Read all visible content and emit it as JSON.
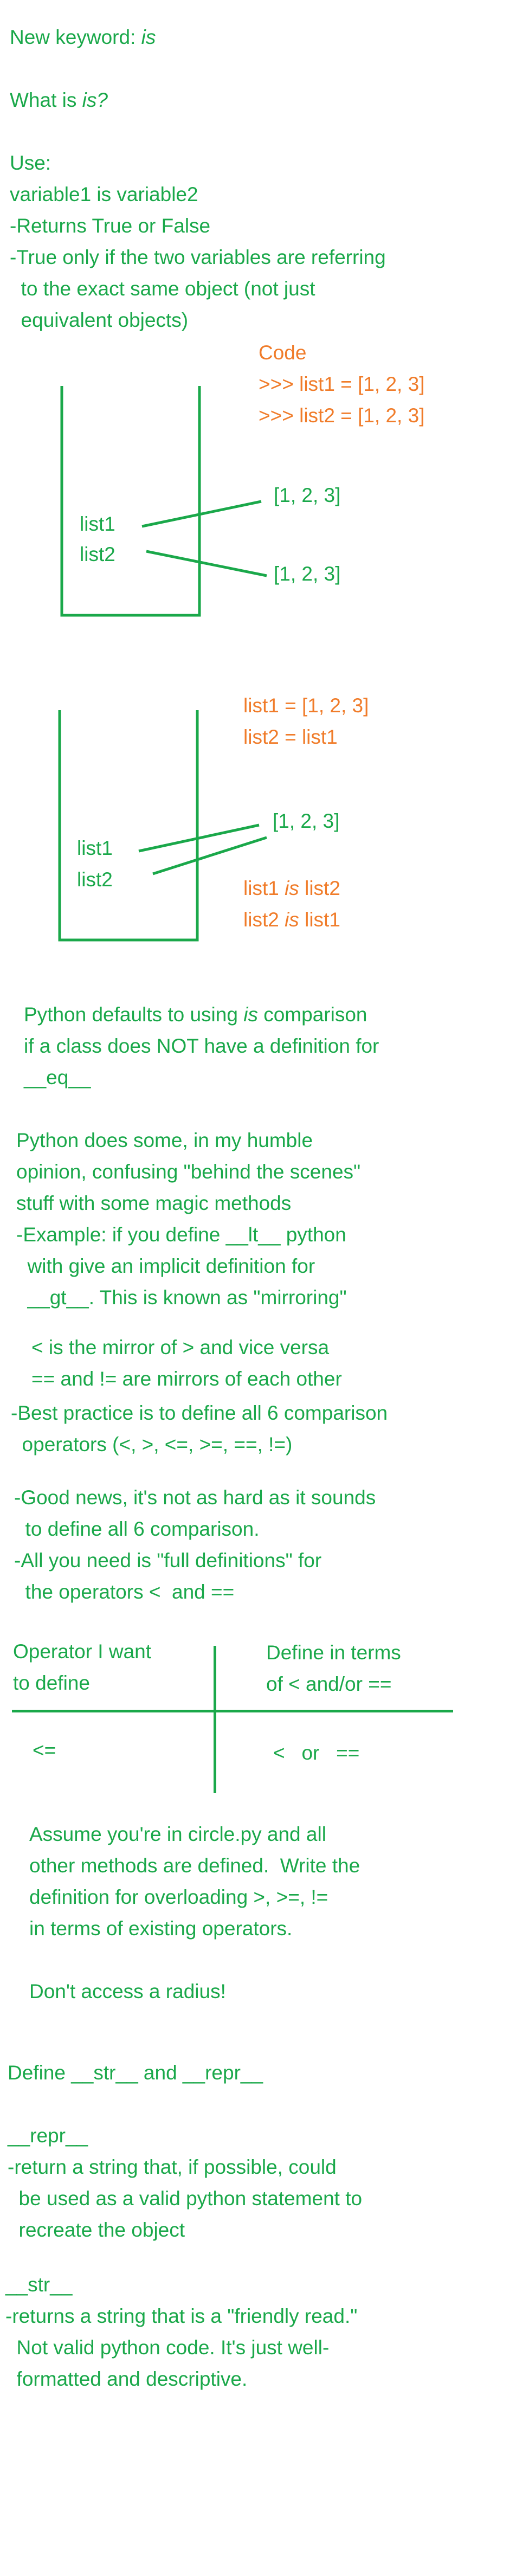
{
  "intro": {
    "new_keyword_prefix": "New keyword: ",
    "new_keyword": "is",
    "what_is_prefix": "What is ",
    "what_is_word": "is?",
    "use_lines": [
      "Use:",
      "variable1 is variable2",
      "-Returns True or False",
      "-True only if the two variables are referring",
      "  to the exact same object (not just",
      "  equivalent objects)"
    ]
  },
  "diagram1": {
    "code_lines": [
      "Code",
      ">>> list1 = [1, 2, 3]",
      ">>> list2 = [1, 2, 3]"
    ],
    "var1": "list1",
    "var2": "list2",
    "obj1": "[1, 2, 3]",
    "obj2": "[1, 2, 3]"
  },
  "diagram2": {
    "code_lines": [
      "list1 = [1, 2, 3]",
      "list2 = list1"
    ],
    "var1": "list1",
    "var2": "list2",
    "obj": "[1, 2, 3]",
    "result1": {
      "pre": "list1 ",
      "kw": "is",
      "post": " list2"
    },
    "result2": {
      "pre": "list2 ",
      "kw": "is",
      "post": " list1"
    }
  },
  "defaults": {
    "line1_pre": "Python defaults to using ",
    "line1_kw": "is",
    "line1_post": " comparison",
    "line2": "if a class does NOT have a definition for",
    "line3": "__eq__"
  },
  "magic": {
    "lines": [
      "Python does some, in my humble",
      "opinion, confusing \"behind the scenes\"",
      "stuff with some magic methods",
      "-Example: if you define __lt__ python",
      "  with give an implicit definition for",
      "  __gt__. This is known as \"mirroring\""
    ],
    "mirror_lines": [
      "< is the mirror of > and vice versa",
      "== and != are mirrors of each other"
    ],
    "best_practice": [
      "-Best practice is to define all 6 comparison",
      "  operators (<, >, <=, >=, ==, !=)"
    ],
    "good_news": [
      "-Good news, it's not as hard as it sounds",
      "  to define all 6 comparison.",
      "-All you need is \"full definitions\" for",
      "  the operators <  and =="
    ]
  },
  "table": {
    "header_left": [
      "Operator I want",
      "to define"
    ],
    "header_right": [
      "Define in terms",
      "of < and/or =="
    ],
    "row_left": "<=",
    "row_right": "<   or   =="
  },
  "exercise": {
    "lines": [
      "Assume you're in circle.py and all",
      "other methods are defined.  Write the",
      "definition for overloading >, >=, !=",
      "in terms of existing operators."
    ],
    "note": "Don't access a radius!"
  },
  "str_repr": {
    "heading": "Define __str__ and __repr__",
    "repr_title": "__repr__",
    "repr_lines": [
      "-return a string that, if possible, could",
      "  be used as a valid python statement to",
      "  recreate the object"
    ],
    "str_title": "__str__",
    "str_lines": [
      "-returns a string that is a \"friendly read.\"",
      "  Not valid python code. It's just well-",
      "  formatted and descriptive."
    ]
  },
  "colors": {
    "green": "#1aa84a",
    "orange": "#f07c2a"
  }
}
